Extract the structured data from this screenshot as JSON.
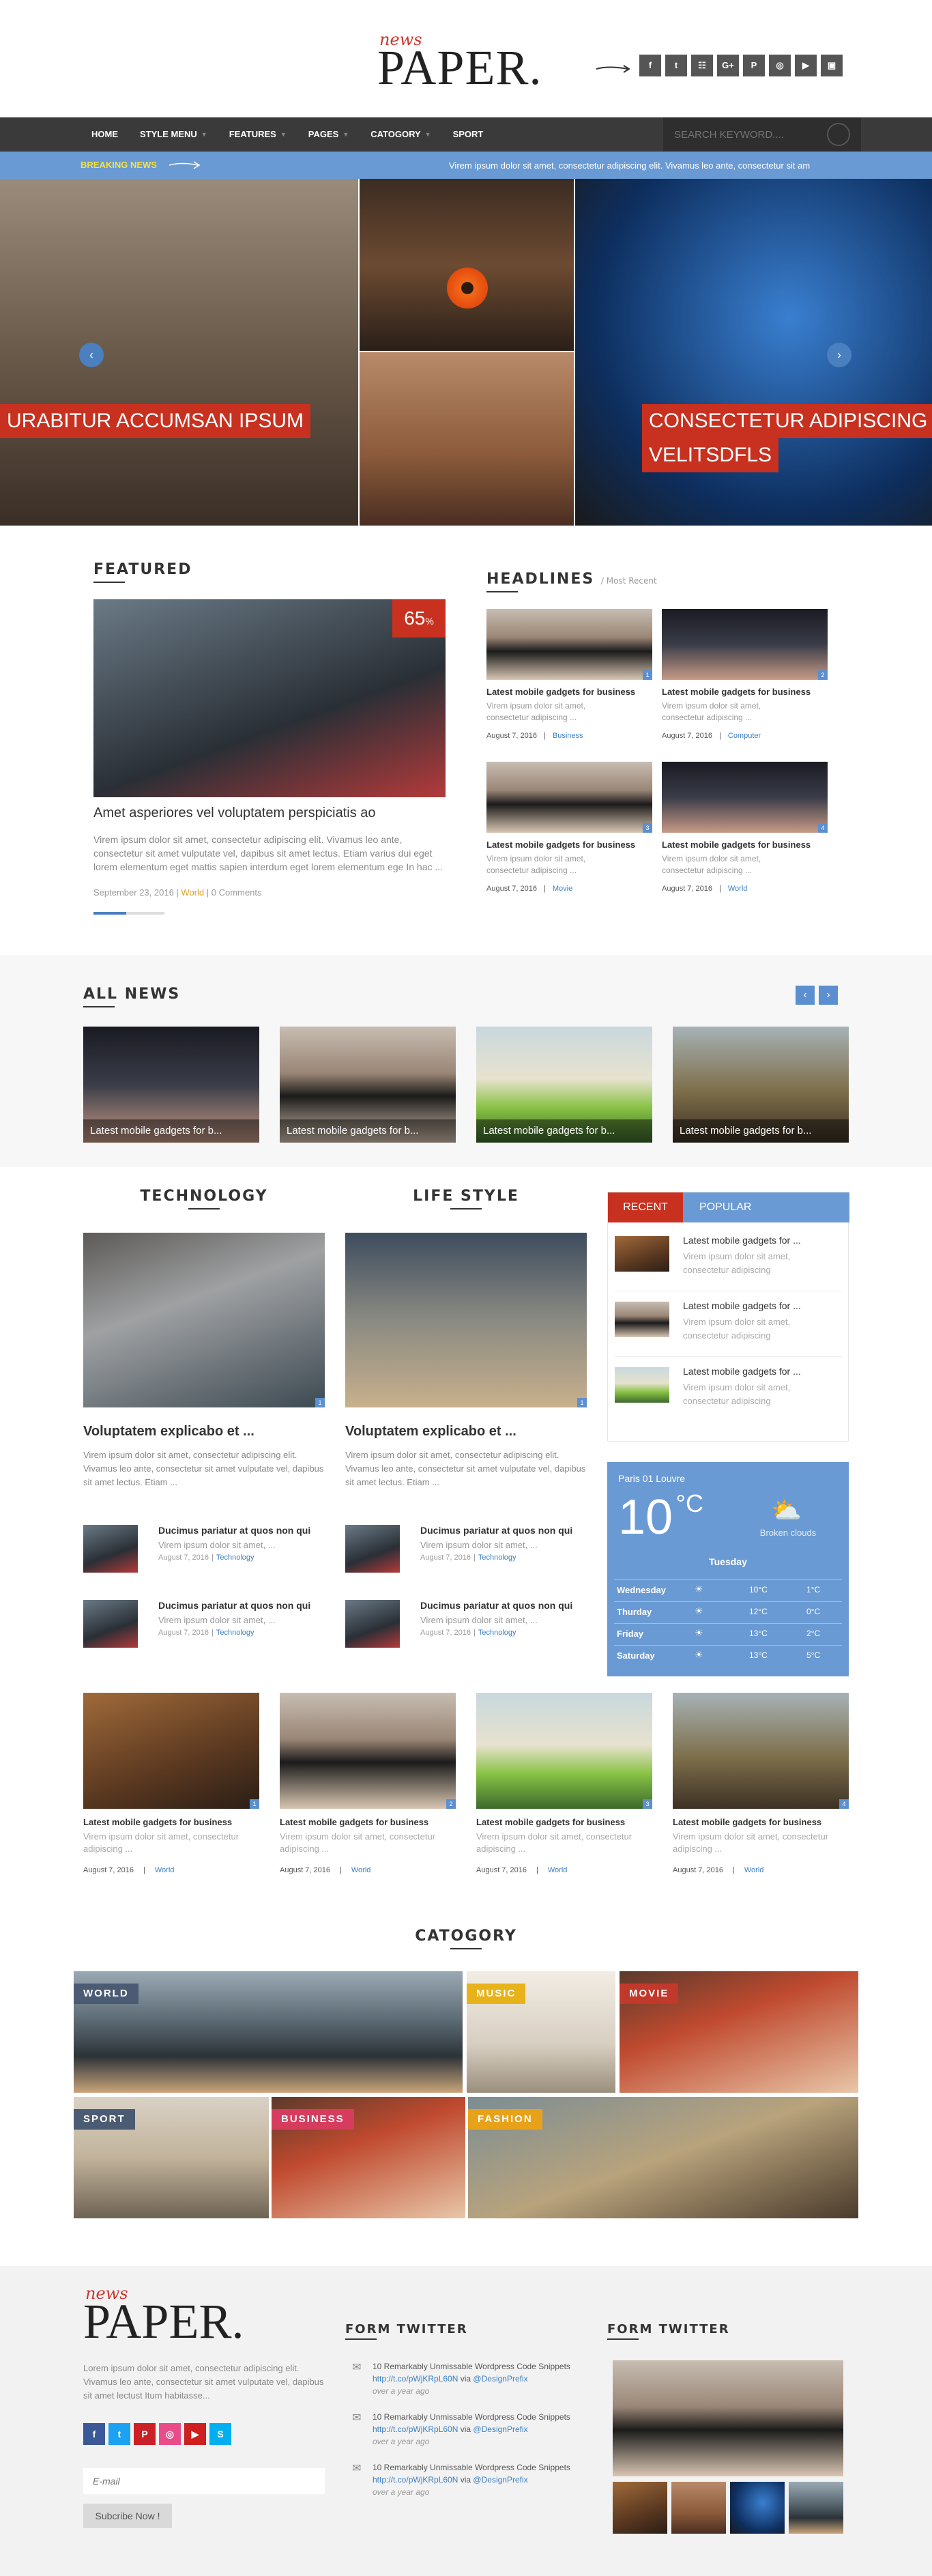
{
  "header": {
    "logo_small": "news",
    "logo_main": "PAPER.",
    "social_icons": [
      "facebook-icon",
      "twitter-icon",
      "rss-icon",
      "google-plus-icon",
      "pinterest-icon",
      "dribbble-icon",
      "youtube-icon",
      "instagram-icon"
    ],
    "social_glyphs": [
      "f",
      "t",
      "☷",
      "G+",
      "P",
      "◎",
      "▶",
      "▣"
    ]
  },
  "nav": {
    "items": [
      "HOME",
      "STYLE MENU",
      "FEATURES",
      "PAGES",
      "CATOGORY",
      "SPORT"
    ],
    "search_placeholder": "SEARCH KEYWORD...."
  },
  "breaking": {
    "label": "BREAKING NEWS",
    "ticker": "Virem ipsum dolor sit amet, consectetur adipiscing elit. Vivamus leo ante, consectetur sit am"
  },
  "hero": {
    "left_caption": "URABITUR ACCUMSAN IPSUM",
    "right_caption_line1": "CONSECTETUR ADIPISCING",
    "right_caption_line2": "VELITSDFLS"
  },
  "featured": {
    "heading": "FEATURED",
    "badge_value": "65",
    "badge_unit": "%",
    "title": "Amet asperiores vel voluptatem perspiciatis ao",
    "excerpt": "Virem ipsum dolor sit amet, consectetur adipiscing elit. Vivamus leo ante, consectetur sit amet vulputate vel, dapibus sit amet lectus. Etiam varius dui eget lorem elementum eget mattis sapien interdum eget lorem elementum ege In hac ...",
    "date": "September 23, 2016",
    "category": "World",
    "comments": "0 Comments"
  },
  "headlines": {
    "heading": "HEADLINES",
    "sub": "/ Most Recent",
    "items": [
      {
        "title": "Latest mobile gadgets for business",
        "excerpt": "Virem ipsum dolor sit amet, consectetur adipiscing ...",
        "date": "August 7, 2016",
        "cat": "Business",
        "num": "1"
      },
      {
        "title": "Latest mobile gadgets for business",
        "excerpt": "Virem ipsum dolor sit amet, consectetur adipiscing ...",
        "date": "August 7, 2016",
        "cat": "Computer",
        "num": "2"
      },
      {
        "title": "Latest mobile gadgets for business",
        "excerpt": "Virem ipsum dolor sit amet, consectetur adipiscing ...",
        "date": "August 7, 2016",
        "cat": "Movie",
        "num": "3"
      },
      {
        "title": "Latest mobile gadgets for business",
        "excerpt": "Virem ipsum dolor sit amet, consectetur adipiscing ...",
        "date": "August 7, 2016",
        "cat": "World",
        "num": "4"
      }
    ]
  },
  "all_news": {
    "heading": "ALL NEWS",
    "items": [
      "Latest mobile gadgets for b...",
      "Latest mobile gadgets for b...",
      "Latest mobile gadgets for b...",
      "Latest mobile gadgets for b..."
    ]
  },
  "technology": {
    "heading": "TECHNOLOGY",
    "title": "Voluptatem explicabo et ...",
    "excerpt": "Virem ipsum dolor sit amet, consectetur adipiscing elit. Vivamus leo ante, consectetur sit amet vulputate vel, dapibus sit amet lectus. Etiam ...",
    "num": "1",
    "small": [
      {
        "title": "Ducimus pariatur at quos non qui",
        "excerpt": "Virem ipsum dolor sit amet, ...",
        "date": "August 7, 2016",
        "cat": "Technology"
      },
      {
        "title": "Ducimus pariatur at quos non qui",
        "excerpt": "Virem ipsum dolor sit amet, ...",
        "date": "August 7, 2016",
        "cat": "Technology"
      }
    ]
  },
  "lifestyle": {
    "heading": "LIFE STYLE",
    "title": "Voluptatem explicabo et ...",
    "excerpt": "Virem ipsum dolor sit amet, consectetur adipiscing elit. Vivamus leo ante, consectetur sit amet vulputate vel, dapibus sit amet lectus. Etiam ...",
    "num": "1",
    "small": [
      {
        "title": "Ducimus pariatur at quos non qui",
        "excerpt": "Virem ipsum dolor sit amet, ...",
        "date": "August 7, 2016",
        "cat": "Technology"
      },
      {
        "title": "Ducimus pariatur at quos non qui",
        "excerpt": "Virem ipsum dolor sit amet, ...",
        "date": "August 7, 2016",
        "cat": "Technology"
      }
    ]
  },
  "tabs": {
    "recent": "RECENT",
    "popular": "POPULAR",
    "items": [
      {
        "title": "Latest mobile gadgets for ...",
        "excerpt": "Virem ipsum dolor sit amet, consectetur adipiscing"
      },
      {
        "title": "Latest mobile gadgets for ...",
        "excerpt": "Virem ipsum dolor sit amet, consectetur adipiscing"
      },
      {
        "title": "Latest mobile gadgets for ...",
        "excerpt": "Virem ipsum dolor sit amet, consectetur adipiscing"
      }
    ]
  },
  "weather": {
    "location": "Paris 01 Louvre",
    "temp": "10",
    "unit": "°C",
    "condition": "Broken clouds",
    "today": "Tuesday",
    "days": [
      {
        "day": "Wednesday",
        "hi": "10°C",
        "lo": "1°C"
      },
      {
        "day": "Thurday",
        "hi": "12°C",
        "lo": "0°C"
      },
      {
        "day": "Friday",
        "hi": "13°C",
        "lo": "2°C"
      },
      {
        "day": "Saturday",
        "hi": "13°C",
        "lo": "5°C"
      }
    ]
  },
  "grid4": [
    {
      "title": "Latest mobile gadgets for business",
      "excerpt": "Virem ipsum dolor sit amet, consectetur adipiscing ...",
      "date": "August 7, 2016",
      "cat": "World",
      "num": "1"
    },
    {
      "title": "Latest mobile gadgets for business",
      "excerpt": "Virem ipsum dolor sit amet, consectetur adipiscing ...",
      "date": "August 7, 2016",
      "cat": "World",
      "num": "2"
    },
    {
      "title": "Latest mobile gadgets for business",
      "excerpt": "Virem ipsum dolor sit amet, consectetur adipiscing ...",
      "date": "August 7, 2016",
      "cat": "World",
      "num": "3"
    },
    {
      "title": "Latest mobile gadgets for business",
      "excerpt": "Virem ipsum dolor sit amet, consectetur adipiscing ...",
      "date": "August 7, 2016",
      "cat": "World",
      "num": "4"
    }
  ],
  "category": {
    "heading": "CATOGORY",
    "tiles": [
      {
        "label": "WORLD",
        "color": "#4b5b73"
      },
      {
        "label": "MUSIC",
        "color": "#e8b21a"
      },
      {
        "label": "MOVIE",
        "color": "#c0392b"
      },
      {
        "label": "SPORT",
        "color": "#4b5b73"
      },
      {
        "label": "BUSINESS",
        "color": "#d63c5e"
      },
      {
        "label": "FASHION",
        "color": "#e8a21a"
      }
    ]
  },
  "footer": {
    "logo_small": "news",
    "logo_main": "PAPER.",
    "about": "Lorem ipsum dolor sit amet, consectetur adipiscing elit. Vivamus leo ante, consectetur sit amet vulputate vel, dapibus sit amet lectust Itum habitasse...",
    "social_glyphs": [
      "f",
      "t",
      "P",
      "◎",
      "▶",
      "S"
    ],
    "social_colors": [
      "#3b5998",
      "#1da1f2",
      "#cb2027",
      "#ea4c89",
      "#cd201f",
      "#00aff0"
    ],
    "email_placeholder": "E-mail",
    "subscribe": "Subcribe Now !",
    "twitter_heading": "FORM TWITTER",
    "tweets": [
      {
        "text": "10 Remarkably Unmissable Wordpress Code Snippets",
        "link": "http://t.co/pWjKRpL60N",
        "via": "via",
        "handle": "@DesignPrefix",
        "time": "over a year ago"
      },
      {
        "text": "10 Remarkably Unmissable Wordpress Code Snippets",
        "link": "http://t.co/pWjKRpL60N",
        "via": "via",
        "handle": "@DesignPrefix",
        "time": "over a year ago"
      },
      {
        "text": "10 Remarkably Unmissable Wordpress Code Snippets",
        "link": "http://t.co/pWjKRpL60N",
        "via": "via",
        "handle": "@DesignPrefix",
        "time": "over a year ago"
      }
    ],
    "twitter2_heading": "FORM TWITTER"
  }
}
